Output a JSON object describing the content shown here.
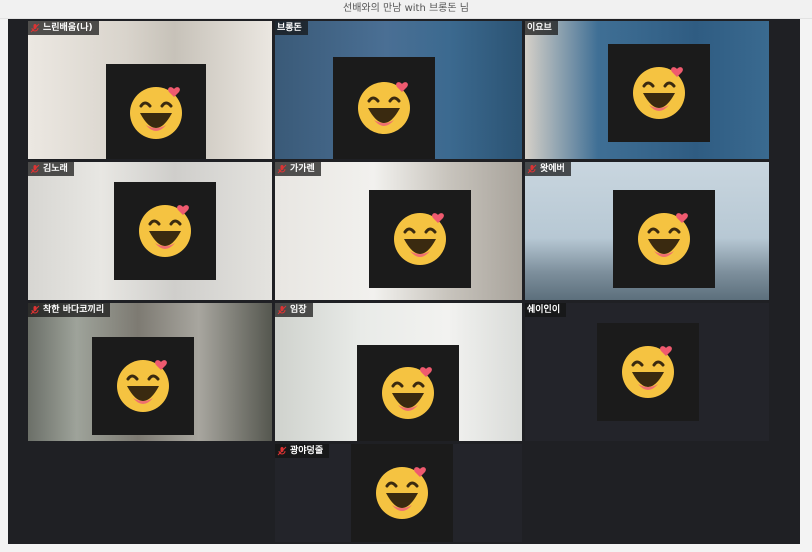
{
  "window": {
    "title": "선배와의 만남 with 브롱돈 님"
  },
  "colors": {
    "active_border": "#24d0ae",
    "cover": "#1b1b1b",
    "gallery_bg": "#1f2024",
    "muted_mic": "#d33"
  },
  "participants": [
    {
      "name": "느린배움(나)",
      "muted": true,
      "active": false,
      "camera_on": true
    },
    {
      "name": "브롱돈",
      "muted": false,
      "active": false,
      "camera_on": true
    },
    {
      "name": "이요브",
      "muted": false,
      "active": true,
      "camera_on": true
    },
    {
      "name": "김노래",
      "muted": true,
      "active": false,
      "camera_on": true
    },
    {
      "name": "가가렌",
      "muted": true,
      "active": false,
      "camera_on": true
    },
    {
      "name": "왓에버",
      "muted": true,
      "active": false,
      "camera_on": true
    },
    {
      "name": "착한 바다코끼리",
      "muted": true,
      "active": false,
      "camera_on": true
    },
    {
      "name": "임장",
      "muted": true,
      "active": false,
      "camera_on": true
    },
    {
      "name": "쉐이인이",
      "muted": false,
      "active": false,
      "camera_on": true
    },
    {
      "name": "광야덩줄",
      "muted": true,
      "active": false,
      "camera_on": false
    }
  ],
  "icons": {
    "muted_mic": "muted-mic-icon",
    "face_cover": "laughing-face-icon"
  }
}
